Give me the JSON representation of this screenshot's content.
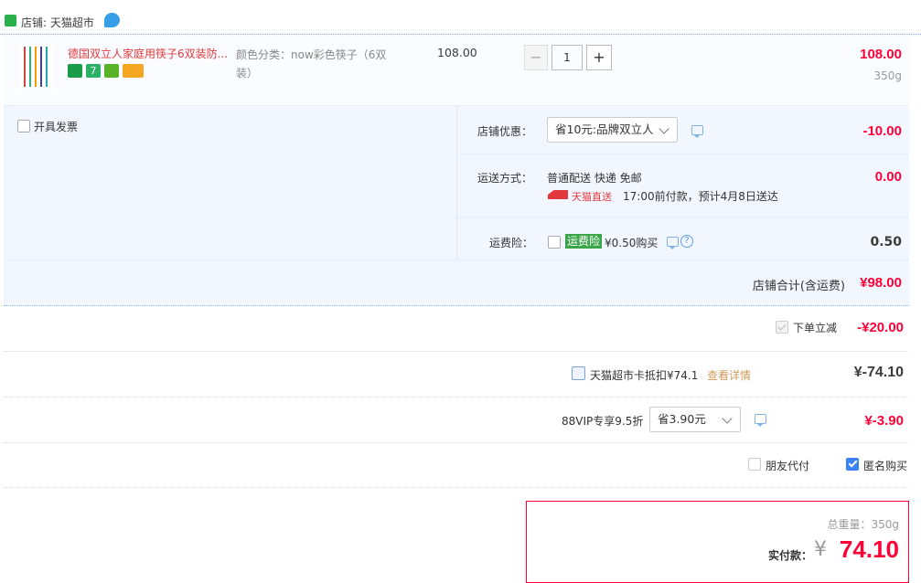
{
  "shop": {
    "label": "店铺: 天猫超市"
  },
  "product": {
    "title": "德国双立人家庭用筷子6双装防...",
    "sku_label": "颜色分类：now彩色筷子（6双装）",
    "unit_price": "108.00",
    "quantity": "1",
    "subtotal": "108.00",
    "weight": "350g",
    "minus": "−",
    "plus": "+"
  },
  "invoice": {
    "label": "开具发票"
  },
  "shop_discount": {
    "label": "店铺优惠：",
    "selected": "省10元:品牌双立人",
    "amount": "-10.00"
  },
  "shipping": {
    "label": "运送方式：",
    "method": "普通配送 快递 免邮",
    "brand": "天猫直送",
    "eta": "17:00前付款，预计4月8日送达",
    "amount": "0.00"
  },
  "insurance": {
    "label": "运费险：",
    "badge": "运费险",
    "price": "¥0.50购买",
    "amount": "0.50"
  },
  "shop_total": {
    "label": "店铺合计(含运费)",
    "amount": "¥98.00"
  },
  "instant_discount": {
    "label": "下单立减",
    "amount": "-¥20.00"
  },
  "card": {
    "label": "天猫超市卡抵扣¥74.1",
    "link": "查看详情",
    "amount": "¥-74.10"
  },
  "vip": {
    "label": "88VIP专享9.5折",
    "selected": "省3.90元",
    "amount": "¥-3.90"
  },
  "options": {
    "friend_pay": "朋友代付",
    "anonymous": "匿名购买"
  },
  "summary": {
    "weight_label": "总重量：350g",
    "pay_label": "实付款：",
    "currency": "¥",
    "amount": "74.10"
  },
  "colors": {
    "accent": "#ff0036",
    "link": "#3c78c2",
    "panel": "#f2f7ff",
    "border": "#b2d1ff"
  }
}
